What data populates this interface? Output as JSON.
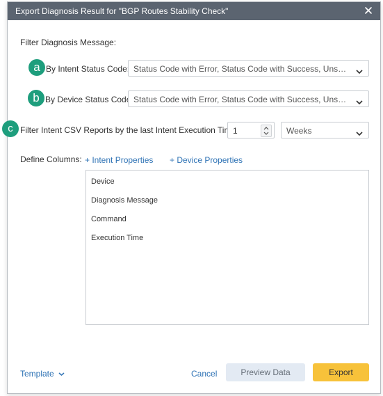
{
  "dialog": {
    "title": "Export Diagnosis Result for \"BGP Routes Stability Check\""
  },
  "filter_section": {
    "heading": "Filter Diagnosis Message:",
    "intent_status": {
      "badge": "a",
      "label": "By Intent Status Code:",
      "value": "Status Code with Error, Status Code with Success, Unsp..."
    },
    "device_status": {
      "badge": "b",
      "label": "By Device Status Code:",
      "value": "Status Code with Error, Status Code with Success, Unsp..."
    }
  },
  "csv_filter": {
    "badge": "c",
    "label": "Filter Intent CSV Reports by the last Intent Execution Time:",
    "amount": "1",
    "unit": "Weeks"
  },
  "columns": {
    "label": "Define Columns:",
    "intent_properties_link": "+ Intent Properties",
    "device_properties_link": "+ Device Properties",
    "items": [
      "Device",
      "Diagnosis Message",
      "Command",
      "Execution Time"
    ]
  },
  "footer": {
    "template_label": "Template",
    "cancel_label": "Cancel",
    "preview_label": "Preview Data",
    "export_label": "Export"
  },
  "colors": {
    "titlebar": "#5b6470",
    "badge": "#1e9e7d",
    "link": "#2f73b5",
    "export": "#f7c23a",
    "preview": "#e3eaf3"
  }
}
